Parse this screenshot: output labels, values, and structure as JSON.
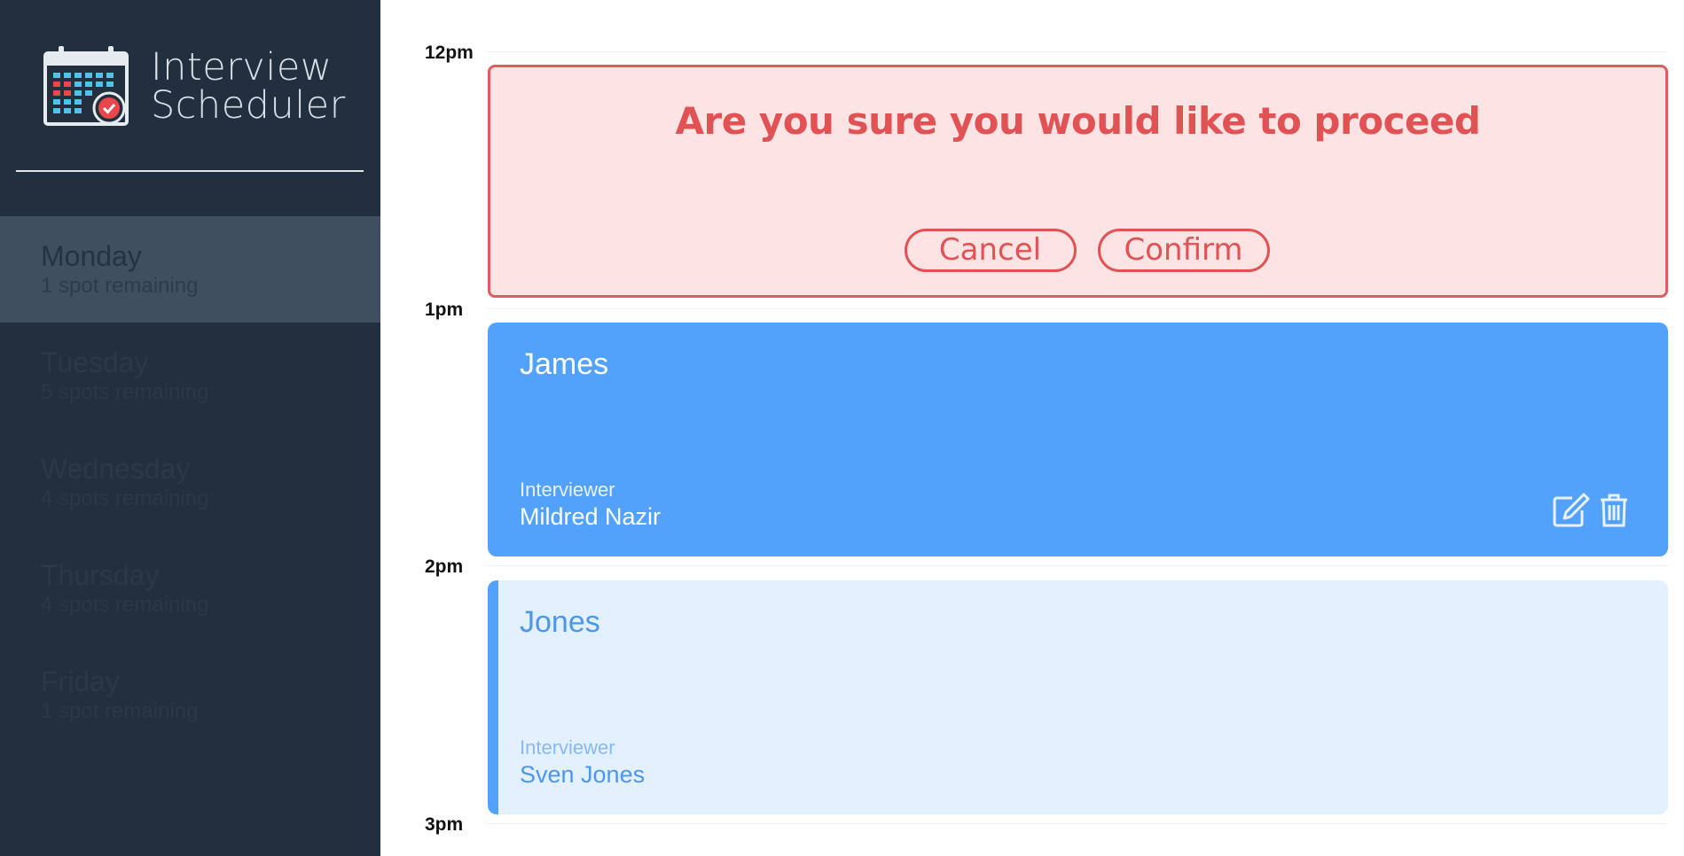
{
  "app": {
    "title_line1": "Interview",
    "title_line2": "Scheduler"
  },
  "days": [
    {
      "name": "Monday",
      "spots": "1 spot remaining",
      "selected": true
    },
    {
      "name": "Tuesday",
      "spots": "5 spots remaining",
      "selected": false
    },
    {
      "name": "Wednesday",
      "spots": "4 spots remaining",
      "selected": false
    },
    {
      "name": "Thursday",
      "spots": "4 spots remaining",
      "selected": false
    },
    {
      "name": "Friday",
      "spots": "1 spot remaining",
      "selected": false
    }
  ],
  "times": [
    "12pm",
    "1pm",
    "2pm",
    "3pm"
  ],
  "confirm": {
    "message": "Are you sure you would like to proceed",
    "cancel_label": "Cancel",
    "confirm_label": "Confirm"
  },
  "appointments": [
    {
      "student": "James",
      "interviewer_label": "Interviewer",
      "interviewer": "Mildred Nazir",
      "edit_icon": "edit-icon",
      "delete_icon": "trash-icon"
    },
    {
      "student": "Jones",
      "interviewer_label": "Interviewer",
      "interviewer": "Sven Jones"
    }
  ],
  "colors": {
    "sidebar": "#222f3e",
    "selected_day": "#404f5f",
    "danger": "#e05254",
    "danger_bg": "#fce4e5",
    "primary": "#52a1fb",
    "primary_light": "#e3f0fe"
  }
}
